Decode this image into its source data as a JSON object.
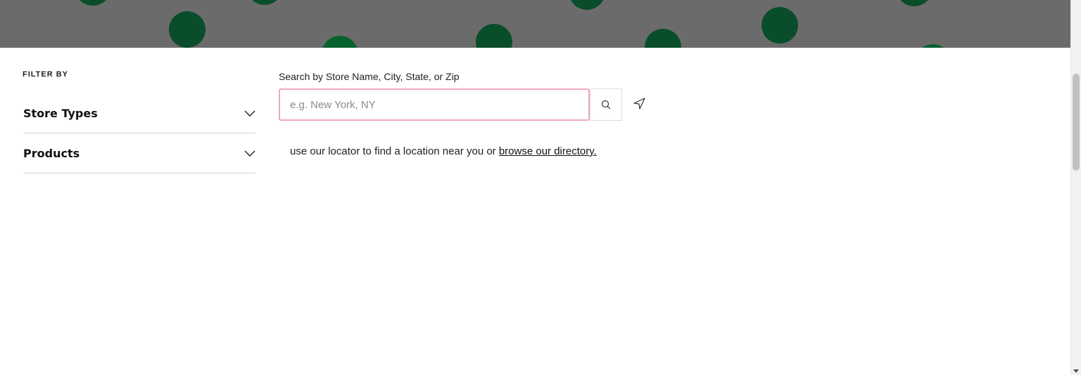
{
  "banner": {
    "background": "#6b6b6b",
    "dot_color": "#0a4d2a"
  },
  "filters": {
    "heading": "FILTER BY",
    "items": [
      {
        "label": "Store Types",
        "icon": "chevron-down-icon"
      },
      {
        "label": "Products",
        "icon": "chevron-down-icon"
      }
    ]
  },
  "search": {
    "label": "Search by Store Name, City, State, or Zip",
    "placeholder": "e.g. New York, NY",
    "value": "",
    "focus_border_color": "#f0a8bd",
    "search_icon": "search-icon",
    "locate_icon": "location-arrow-icon"
  },
  "locator": {
    "text": "use our locator to find a location near you or ",
    "link": "browse our directory."
  }
}
